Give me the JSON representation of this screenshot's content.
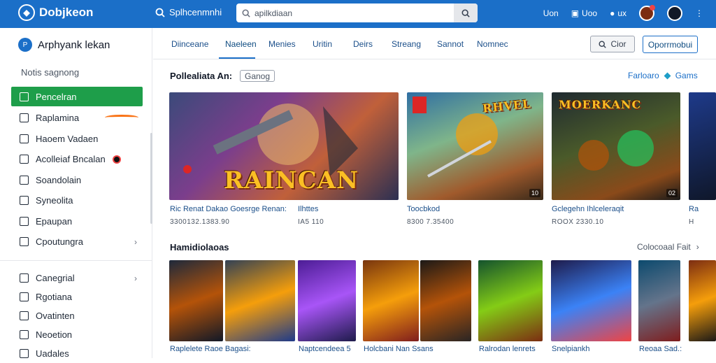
{
  "topbar": {
    "logo": "Dobjkeon",
    "search_label": "Splhcenmnhi",
    "search_value": "apilkdiaan",
    "right_text": "Uon",
    "right_item2": "Uoo",
    "right_item3": "ux"
  },
  "sidebar": {
    "brand": "Arphyank lekan",
    "section_label": "Notis sagnong",
    "items": [
      {
        "label": "Pencelran"
      },
      {
        "label": "Raplamina"
      },
      {
        "label": "Haoem Vadaen"
      },
      {
        "label": "Acolleiaf Bncalan"
      },
      {
        "label": "Soandolain"
      },
      {
        "label": "Syneolita"
      },
      {
        "label": "Epaupan"
      },
      {
        "label": "Cpoutungra"
      }
    ],
    "items2": [
      {
        "label": "Canegrial"
      },
      {
        "label": "Rgotiana"
      },
      {
        "label": "Ovatinten"
      },
      {
        "label": "Neoetion"
      },
      {
        "label": "Uadales"
      }
    ]
  },
  "tabs": [
    "Diinceane",
    "Naeleen",
    "Menies",
    "Uritin",
    "Deirs",
    "Streang",
    "Sannot",
    "Nomnec"
  ],
  "buttons": {
    "outline": "Cior",
    "primary": "Oporrmobui"
  },
  "row1": {
    "title": "Pollealiata An:",
    "chip": "Ganog",
    "right_a": "Farloaro",
    "right_b": "Gams"
  },
  "row1_cards": [
    {
      "art": "RAINCAN",
      "title": "Ric Renat Dakao Goesrge Renan:",
      "title2": "Ilhttes",
      "sub": "3300132.1383.90",
      "sub2": "IA5 110"
    },
    {
      "art": "RHVEL",
      "tag": "10",
      "title": "Toocbkod",
      "sub": "8300 7.35400"
    },
    {
      "art": "MOERKANC",
      "tag": "02",
      "title": "Gclegehn Ihlceleraqit",
      "sub": "ROOX 2330.10"
    },
    {
      "title": "Ra",
      "sub": "H"
    }
  ],
  "row2": {
    "title": "Hamidiolaoas",
    "right": "Colocoaal Fait"
  },
  "row2_titles": [
    "Raplelete Raoe Bagasi:",
    "Naptcendeea 5",
    "Holcbani Nan Ssans",
    "Ralrodan lenrets",
    "Snelpiankh",
    "Reoaa Sad.:"
  ]
}
